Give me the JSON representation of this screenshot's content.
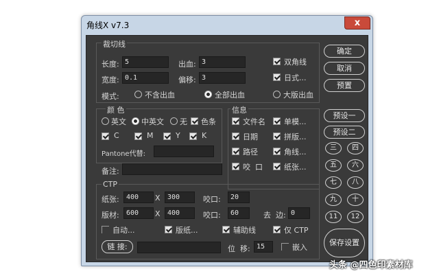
{
  "window": {
    "title": "角线X v7.3",
    "close": "x"
  },
  "cut": {
    "group": "裁切线",
    "length_label": "长度:",
    "length": "5",
    "bleed_label": "出血:",
    "bleed": "3",
    "width_label": "宽度:",
    "width": "0.1",
    "offset_label": "偏移:",
    "offset": "3",
    "mode_label": "模式:",
    "mode_options": [
      "不含出血",
      "全部出血",
      "大版出血"
    ],
    "double_corner": "双角线",
    "japanese": "日式..."
  },
  "color": {
    "group": "颜  色",
    "options": [
      "英文",
      "中英文",
      "无"
    ],
    "color_bar": "色条",
    "channels": [
      "C",
      "M",
      "Y",
      "K"
    ],
    "pantone_label": "Pantone代替:",
    "pantone": ""
  },
  "info": {
    "group": "信息",
    "items": [
      "文件名",
      "单模...",
      "日期",
      "拼版...",
      "路径",
      "角线...",
      "咬  口",
      "纸张..."
    ]
  },
  "note": {
    "label": "备注:",
    "value": ""
  },
  "ctp": {
    "group": "CTP",
    "paper_label": "纸张:",
    "paper_w": "400",
    "paper_h": "300",
    "x1": "X",
    "grip_label": "咬口:",
    "grip1": "20",
    "plate_label": "版材:",
    "plate_w": "600",
    "plate_h": "400",
    "x2": "X",
    "grip2": "60",
    "edge_label": "去  边:",
    "edge": "0",
    "auto": "自动...",
    "plate_chk": "版纸...",
    "guide": "辅助线",
    "only_ctp": "仅 CTP",
    "link_label": "链  接:",
    "link": "",
    "shift_label": "位  移:",
    "shift": "15",
    "embed": "嵌入"
  },
  "buttons": {
    "ok": "确定",
    "cancel": "取消",
    "preset": "预置",
    "preset1": "预设一",
    "preset2": "预设二",
    "nums": [
      "三",
      "四",
      "五",
      "六",
      "七",
      "八",
      "九",
      "十",
      "11",
      "12"
    ],
    "save": "保存设置"
  },
  "watermark": "头条 @四色印素材库"
}
